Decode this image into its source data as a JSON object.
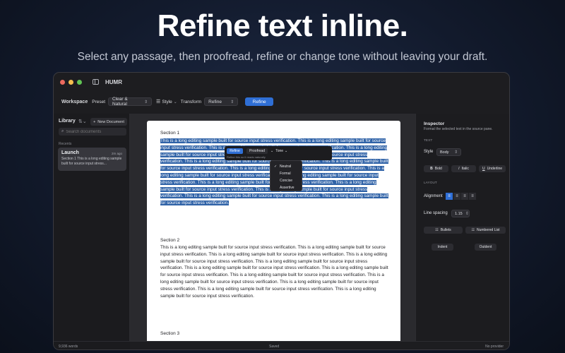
{
  "hero": {
    "title": "Refine text inline.",
    "subtitle": "Select any passage, then proofread, refine or change tone without leaving your draft."
  },
  "window": {
    "title": "HUMR",
    "traffic": [
      "#ed6a5e",
      "#f5bf4f",
      "#61c554"
    ]
  },
  "toolbar": {
    "workspace_label": "Workspace",
    "preset_label": "Preset",
    "preset_value": "Clear & Natural",
    "style_label": "Style",
    "transform_label": "Transform",
    "transform_value": "Refine",
    "refine_button": "Refine"
  },
  "sidebar": {
    "library_label": "Library",
    "new_document": "New Document",
    "search_placeholder": "Search documents",
    "recents_label": "Recents",
    "doc": {
      "title": "Launch",
      "time": "2m ago",
      "preview": "Section 1 This is a long editing sample built for source input stress..."
    },
    "word_count": "9,936 words"
  },
  "document": {
    "section1_heading": "Section 1",
    "section1_text": "This is a long editing sample built for source input stress verification. This is a long editing sample built for source input stress verification. This is a long editing sample built for source input stress verification. This is a long editing sample built for source input stress verification. This is a long editing sample built for source input stress verification. This is a long editing sample built for source input stress verification. This is a long editing sample built for source input stress verification. This is a long editing sample built for source input stress verification. This is a long editing sample built for source input stress verification. This is a long editing sample built for source input stress verification. This is a long editing sample built for source input stress verification. This is a long editing sample built for source input stress verification. This is a long editing sample built for source input stress verification. This is a long editing sample built for source input stress verification. This is a long editing sample built for source input stress verification.",
    "section2_heading": "Section 2",
    "section2_text": "This is a long editing sample built for source input stress verification. This is a long editing sample built for source input stress verification. This is a long editing sample built for source input stress verification. This is a long editing sample built for source input stress verification. This is a long editing sample built for source input stress verification. This is a long editing sample built for source input stress verification. This is a long editing sample built for source input stress verification. This is a long editing sample built for source input stress verification. This is a long editing sample built for source input stress verification. This is a long editing sample built for source input stress verification. This is a long editing sample built for source input stress verification. This is a long editing sample built for source input stress verification.",
    "section3_heading": "Section 3"
  },
  "floating_toolbar": {
    "refine": "Refine",
    "proofread": "Proofread",
    "tone": "Tone",
    "note": "Refine this so it reads naturally"
  },
  "tone_menu": {
    "items": [
      "Neutral",
      "Formal",
      "Concise",
      "Assertive"
    ],
    "checked": "Neutral"
  },
  "inspector": {
    "title": "Inspector",
    "description": "Format the selected text in the source pane.",
    "text_section": "TEXT",
    "style_label": "Style",
    "style_value": "Body",
    "bold": "Bold",
    "italic": "Italic",
    "underline": "Underline",
    "layout_section": "LAYOUT",
    "alignment_label": "Alignment",
    "line_spacing_label": "Line spacing",
    "line_spacing_value": "1.15",
    "bullets": "Bullets",
    "numbered_list": "Numbered List",
    "indent": "Indent",
    "outdent": "Outdent"
  },
  "status": {
    "saved": "Saved",
    "provider": "No provider"
  },
  "colors": {
    "accent": "#2f6fd6",
    "selection": "#2f62a7"
  }
}
